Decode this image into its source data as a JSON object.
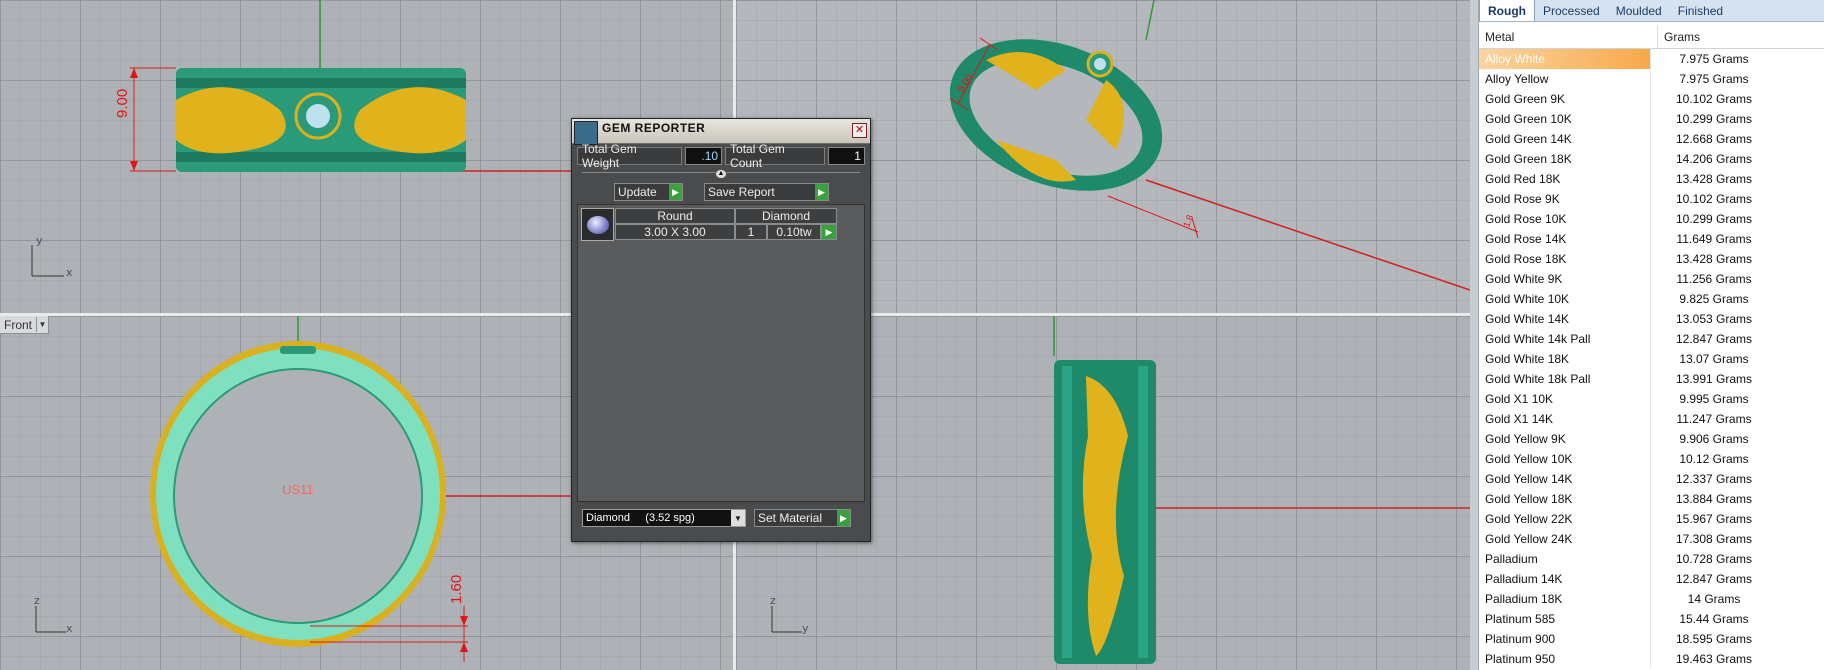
{
  "viewports": {
    "top": {
      "dimension": "9.00",
      "axes": {
        "a1": "y",
        "a2": "x"
      }
    },
    "perspective": {
      "dimension_top": "9.00",
      "dimension_bottom": "1.8"
    },
    "front": {
      "tab_label": "Front",
      "dimension": "1.60",
      "center_label": "US11",
      "axes": {
        "a1": "z",
        "a2": "x"
      }
    },
    "right": {
      "axes": {
        "a1": "z",
        "a2": "y"
      }
    }
  },
  "gem_reporter": {
    "title": "GEM REPORTER",
    "total_weight_label": "Total Gem Weight",
    "total_weight_value": ".10",
    "total_count_label": "Total Gem Count",
    "total_count_value": "1",
    "update_label": "Update",
    "save_label": "Save Report",
    "gem": {
      "shape": "Round",
      "type": "Diamond",
      "size": "3.00 X 3.00",
      "count": "1",
      "weight": "0.10tw"
    },
    "material_select": "Diamond     (3.52 spg)",
    "set_material_label": "Set Material"
  },
  "metal_panel": {
    "tabs": [
      "Rough",
      "Processed",
      "Moulded",
      "Finished"
    ],
    "active_tab": "Rough",
    "columns": {
      "metal": "Metal",
      "grams": "Grams"
    },
    "rows": [
      {
        "metal": "Alloy White",
        "grams": "7.975 Grams"
      },
      {
        "metal": "Alloy Yellow",
        "grams": "7.975 Grams"
      },
      {
        "metal": "Gold Green 9K",
        "grams": "10.102 Grams"
      },
      {
        "metal": "Gold Green 10K",
        "grams": "10.299 Grams"
      },
      {
        "metal": "Gold Green 14K",
        "grams": "12.668 Grams"
      },
      {
        "metal": "Gold Green 18K",
        "grams": "14.206 Grams"
      },
      {
        "metal": "Gold Red 18K",
        "grams": "13.428 Grams"
      },
      {
        "metal": "Gold Rose 9K",
        "grams": "10.102 Grams"
      },
      {
        "metal": "Gold Rose 10K",
        "grams": "10.299 Grams"
      },
      {
        "metal": "Gold Rose 14K",
        "grams": "11.649 Grams"
      },
      {
        "metal": "Gold Rose 18K",
        "grams": "13.428 Grams"
      },
      {
        "metal": "Gold White 9K",
        "grams": "11.256 Grams"
      },
      {
        "metal": "Gold White 10K",
        "grams": "9.825 Grams"
      },
      {
        "metal": "Gold White 14K",
        "grams": "13.053 Grams"
      },
      {
        "metal": "Gold White 14k Pall",
        "grams": "12.847 Grams"
      },
      {
        "metal": "Gold White 18K",
        "grams": "13.07 Grams"
      },
      {
        "metal": "Gold White 18k Pall",
        "grams": "13.991 Grams"
      },
      {
        "metal": "Gold X1 10K",
        "grams": "9.995 Grams"
      },
      {
        "metal": "Gold X1 14K",
        "grams": "11.247 Grams"
      },
      {
        "metal": "Gold Yellow 9K",
        "grams": "9.906 Grams"
      },
      {
        "metal": "Gold Yellow 10K",
        "grams": "10.12 Grams"
      },
      {
        "metal": "Gold Yellow 14K",
        "grams": "12.337 Grams"
      },
      {
        "metal": "Gold Yellow 18K",
        "grams": "13.884 Grams"
      },
      {
        "metal": "Gold Yellow 22K",
        "grams": "15.967 Grams"
      },
      {
        "metal": "Gold Yellow 24K",
        "grams": "17.308 Grams"
      },
      {
        "metal": "Palladium",
        "grams": "10.728 Grams"
      },
      {
        "metal": "Palladium 14K",
        "grams": "12.847 Grams"
      },
      {
        "metal": "Palladium 18K",
        "grams": "14 Grams"
      },
      {
        "metal": "Platinum 585",
        "grams": "15.44 Grams"
      },
      {
        "metal": "Platinum 900",
        "grams": "18.595 Grams"
      },
      {
        "metal": "Platinum 950",
        "grams": "19.463 Grams"
      }
    ],
    "selected_index": 0
  }
}
